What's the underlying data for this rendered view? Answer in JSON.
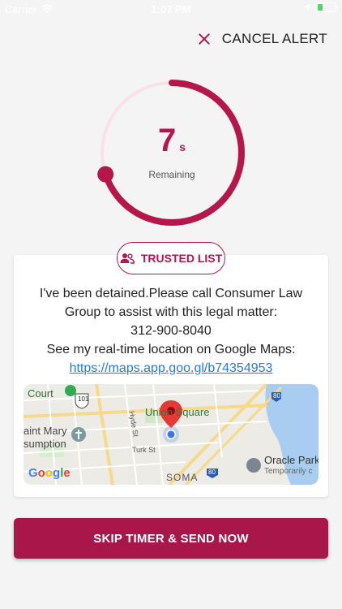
{
  "status_bar": {
    "carrier": "Carrier",
    "time": "1:07 PM"
  },
  "cancel": {
    "label": "CANCEL ALERT"
  },
  "timer": {
    "value": "7",
    "unit": "s",
    "caption": "Remaining",
    "remaining_fraction": 0.7,
    "accent": "#b5174a",
    "track": "#f9e1e8"
  },
  "trusted_list": {
    "label": "TRUSTED LIST"
  },
  "message": {
    "line1": "I've been detained.Please call Consumer Law",
    "line2": "Group to assist with this legal matter:",
    "line3": "312-900-8040",
    "line4": "See my real-time location on Google Maps:",
    "link": "https://maps.app.goo.gl/b74354953"
  },
  "map": {
    "labels": {
      "court": "Court",
      "route101": "101",
      "route80a": "80",
      "route80b": "80",
      "union_square": "Union Square",
      "saint_mary_1": "aint Mary",
      "saint_mary_2": "sumption",
      "hyde": "Hyde St",
      "turk": "Turk St",
      "soma": "SOMA",
      "oracle": "Oracle Park",
      "oracle_status": "Temporarily c",
      "google": "Google"
    }
  },
  "skip_button": {
    "label": "SKIP TIMER & SEND NOW"
  }
}
